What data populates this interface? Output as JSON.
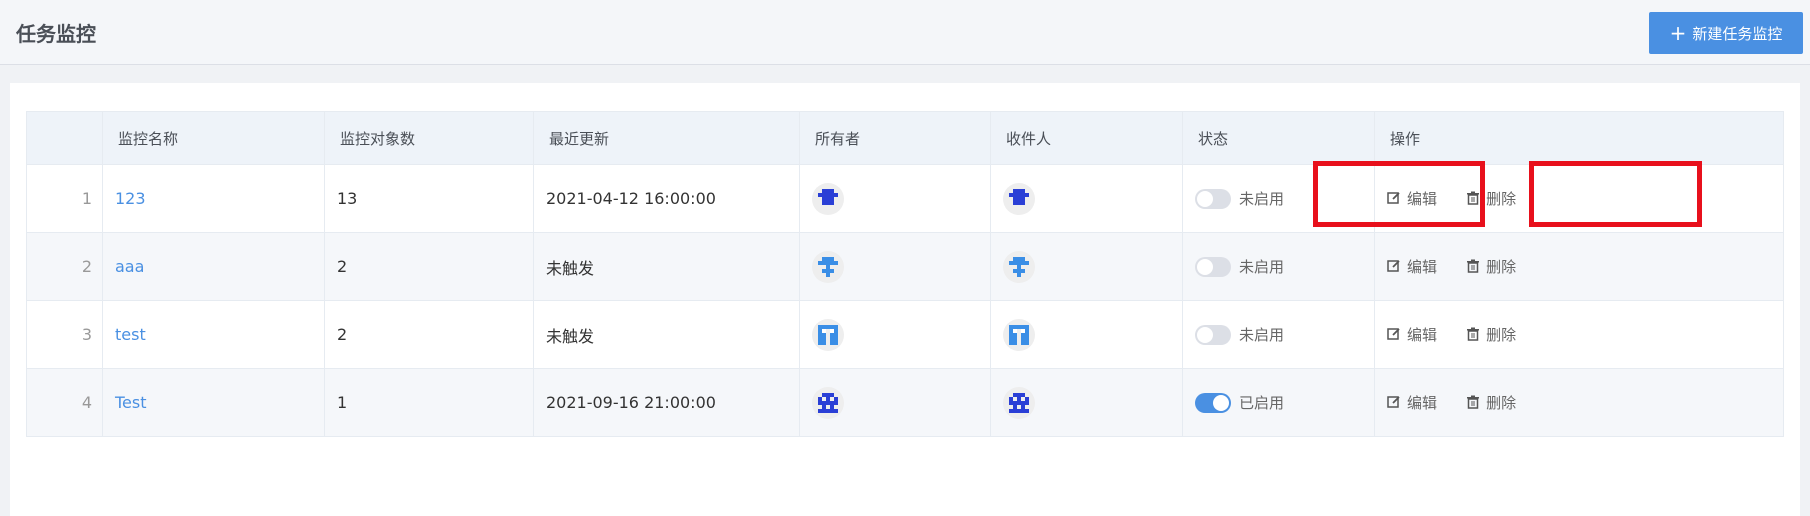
{
  "page": {
    "title": "任务监控",
    "new_button_label": "新建任务监控"
  },
  "table": {
    "headers": [
      "",
      "监控名称",
      "监控对象数",
      "最近更新",
      "所有者",
      "收件人",
      "状态",
      "操作"
    ],
    "rows": [
      {
        "index": "1",
        "name": "123",
        "count": "13",
        "updated": "2021-04-12 16:00:00",
        "owner_avatar": "identicon-avatar",
        "recipient_avatar": "identicon-avatar",
        "status": "未启用",
        "enabled": false
      },
      {
        "index": "2",
        "name": "aaa",
        "count": "2",
        "updated": "未触发",
        "owner_avatar": "identicon-avatar",
        "recipient_avatar": "identicon-avatar",
        "status": "未启用",
        "enabled": false
      },
      {
        "index": "3",
        "name": "test",
        "count": "2",
        "updated": "未触发",
        "owner_avatar": "identicon-avatar",
        "recipient_avatar": "identicon-avatar",
        "status": "未启用",
        "enabled": false
      },
      {
        "index": "4",
        "name": "Test",
        "count": "1",
        "updated": "2021-09-16 21:00:00",
        "owner_avatar": "identicon-avatar",
        "recipient_avatar": "identicon-avatar",
        "status": "已启用",
        "enabled": true
      }
    ],
    "actions": {
      "edit": "编辑",
      "delete": "删除"
    }
  },
  "colors": {
    "primary": "#4a90e2",
    "highlight": "#e8101c",
    "avatar_dark_blue": "#2a3fd6",
    "avatar_light_blue": "#3a8ee6"
  }
}
